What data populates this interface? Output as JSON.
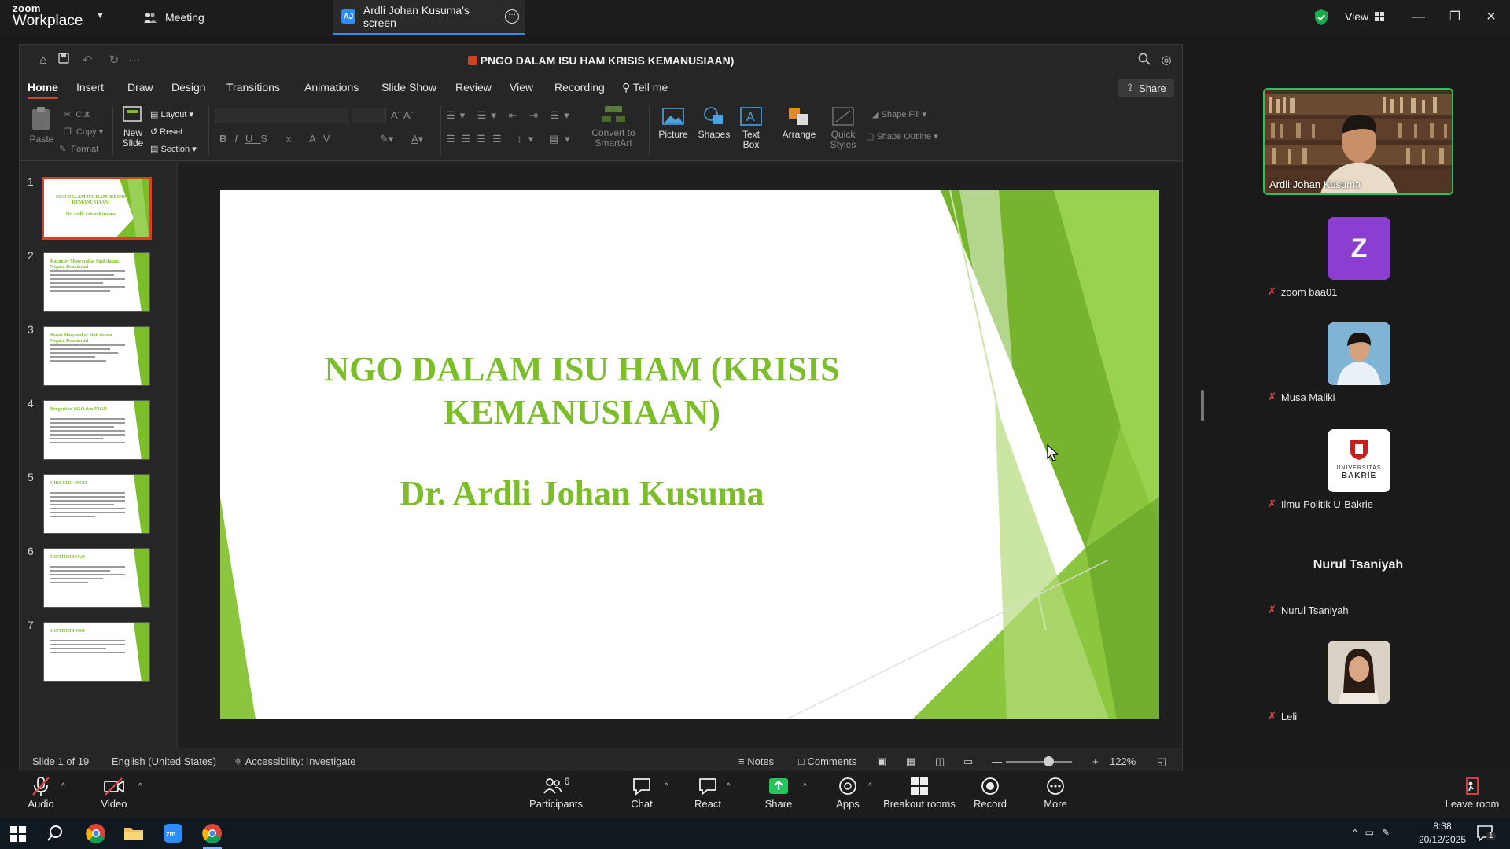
{
  "zoom": {
    "brand_top": "zoom",
    "brand_bottom": "Workplace",
    "tab_meeting": "Meeting",
    "tab_screen_badge": "AJ",
    "tab_screen": "Ardli Johan Kusuma's screen",
    "view_label": "View"
  },
  "ppt": {
    "doc_title": "PNGO DALAM ISU HAM KRISIS KEMANUSIAAN)",
    "tabs": [
      "Home",
      "Insert",
      "Draw",
      "Design",
      "Transitions",
      "Animations",
      "Slide Show",
      "Review",
      "View",
      "Recording"
    ],
    "tell_me": "Tell me",
    "share": "Share",
    "ribbon": {
      "paste": "Paste",
      "cut": "Cut",
      "copy": "Copy",
      "format": "Format",
      "new_slide_1": "New",
      "new_slide_2": "Slide",
      "layout": "Layout",
      "reset": "Reset",
      "section": "Section",
      "convert_1": "Convert to",
      "convert_2": "SmartArt",
      "picture": "Picture",
      "shapes": "Shapes",
      "textbox_1": "Text",
      "textbox_2": "Box",
      "arrange": "Arrange",
      "quick_styles_1": "Quick",
      "quick_styles_2": "Styles",
      "shape_fill": "Shape Fill",
      "shape_outline": "Shape Outline"
    },
    "thumbnails": [
      {
        "num": "1",
        "title": "NGO DALAM ISU HAM (KRISIS KEMANUSIAAN)",
        "subtitle": "Dr. Ardli Johan Kusuma"
      },
      {
        "num": "2",
        "title": "Karakter Masyarakat Sipil dalam Negara Demokrasi"
      },
      {
        "num": "3",
        "title": "Peran Masyarakat Sipil dalam Negara Demokrasi"
      },
      {
        "num": "4",
        "title": "Pengertian NGO dan INGO"
      },
      {
        "num": "5",
        "title": "CIRI-CIRI INGO"
      },
      {
        "num": "6",
        "title": "CONTOH INGO"
      },
      {
        "num": "7",
        "title": "CONTOH INGO"
      }
    ],
    "slide": {
      "title": "NGO DALAM ISU HAM (KRISIS KEMANUSIAAN)",
      "subtitle": "Dr. Ardli Johan Kusuma"
    },
    "status": {
      "slide_of": "Slide 1 of 19",
      "language": "English (United States)",
      "accessibility": "Accessibility: Investigate",
      "notes": "Notes",
      "comments": "Comments",
      "zoom": "122%"
    }
  },
  "participants": [
    {
      "name": "Ardli Johan Kusuma",
      "kind": "video"
    },
    {
      "name": "zoom baa01",
      "initial": "Z",
      "color": "#8a3fd1",
      "muted": true
    },
    {
      "name": "Musa Maliki",
      "muted": true
    },
    {
      "name": "Ilmu Politik U-Bakrie",
      "logo_line1": "UNIVERSITAS",
      "logo_line2": "BAKRIE",
      "muted": true
    },
    {
      "name": "Nurul Tsaniyah",
      "display": "Nurul Tsaniyah",
      "muted": true
    },
    {
      "name": "Leli",
      "muted": true
    }
  ],
  "toolbar": {
    "audio": "Audio",
    "video": "Video",
    "participants": "Participants",
    "participants_count": "6",
    "chat": "Chat",
    "react": "React",
    "share": "Share",
    "apps": "Apps",
    "breakout": "Breakout rooms",
    "record": "Record",
    "more": "More",
    "leave": "Leave room"
  },
  "taskbar": {
    "time": "8:38",
    "date": "20/12/2025",
    "notif_count": "1"
  }
}
